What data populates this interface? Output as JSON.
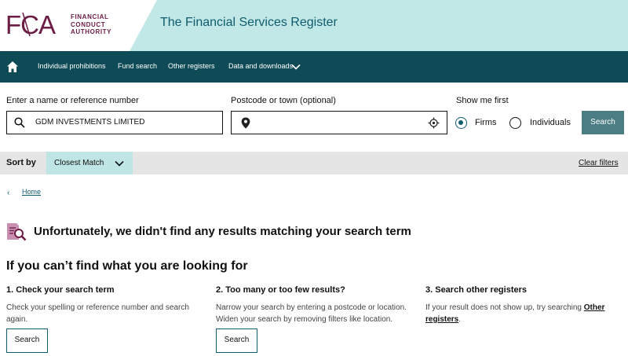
{
  "header": {
    "logo_mark": "FCA",
    "logo_text": [
      "FINANCIAL",
      "CONDUCT",
      "AUTHORITY"
    ],
    "site_title": "The Financial Services Register"
  },
  "nav": {
    "home_icon": "home-icon",
    "items": [
      "Individual prohibitions",
      "Fund search",
      "Other registers",
      "Data and downloads"
    ]
  },
  "search": {
    "name_label": "Enter a name or reference number",
    "name_value": "GDM INVESTMENTS LIMITED",
    "postcode_label": "Postcode or town (optional)",
    "postcode_value": "",
    "show_me_first_label": "Show me first",
    "options": [
      "Firms",
      "Individuals"
    ],
    "selected": "Firms",
    "button": "Search"
  },
  "sort": {
    "label": "Sort by",
    "selected": "Closest Match",
    "clear": "Clear filters"
  },
  "breadcrumb": {
    "home": "Home"
  },
  "results": {
    "no_results": "Unfortunately, we didn't find any results matching your search term",
    "help_title": "If you can’t find what you are looking for",
    "columns": [
      {
        "heading": "1. Check your search term",
        "text": "Check your spelling or reference number and search again.",
        "button": "Search"
      },
      {
        "heading": "2. Too many or too few results?",
        "text": "Narrow your search by entering a postcode or location. Widen your search by removing filters like location.",
        "button": "Search"
      },
      {
        "heading": "3. Search other registers",
        "text": "If your result does not show up, try searching ",
        "link": "Other registers",
        "suffix": "."
      }
    ]
  },
  "colors": {
    "brand": "#6b1d45",
    "nav": "#0e4b57",
    "accent": "#0f5c6e",
    "header_bg": "#c1e8e6"
  }
}
